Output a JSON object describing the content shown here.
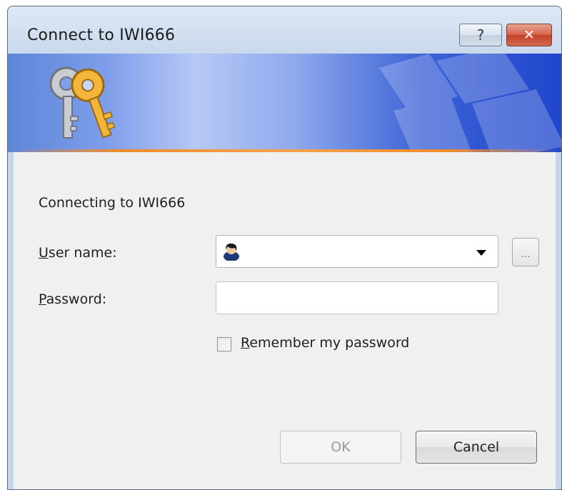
{
  "window": {
    "title": "Connect to IWI666"
  },
  "titlebar": {
    "help_glyph": "?",
    "close_glyph": "✕"
  },
  "banner": {
    "icon": "keys-icon"
  },
  "form": {
    "connecting_text": "Connecting to IWI666",
    "username_label_accel": "U",
    "username_label_rest": "ser name:",
    "username_value": "",
    "username_icon": "user-icon",
    "browse_label": "...",
    "password_label_accel": "P",
    "password_label_rest": "assword:",
    "password_value": "",
    "remember_accel": "R",
    "remember_rest": "emember my password",
    "remember_checked": false
  },
  "buttons": {
    "ok_label": "OK",
    "cancel_label": "Cancel"
  },
  "colors": {
    "banner_accent": "#f08a2a",
    "close_red": "#c4412a",
    "disabled_text": "#9a9a9a"
  }
}
